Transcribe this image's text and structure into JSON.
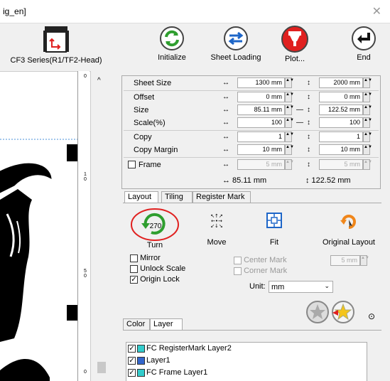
{
  "window": {
    "title": "ig_en]"
  },
  "toolbar": {
    "device": "CF3 Series(R1/TF2-Head)",
    "initialize": "Initialize",
    "sheet_loading": "Sheet Loading",
    "plot": "Plot...",
    "end": "End"
  },
  "ruler": {
    "labels": [
      "0",
      "1 0",
      "5 0",
      "0"
    ]
  },
  "params": {
    "sheet_size": {
      "label": "Sheet Size",
      "w": "1300 mm",
      "h": "2000 mm"
    },
    "offset": {
      "label": "Offset",
      "w": "0 mm",
      "h": "0 mm"
    },
    "size": {
      "label": "Size",
      "w": "85.11 mm",
      "h": "122.52 mm"
    },
    "scale": {
      "label": "Scale(%)",
      "w": "100",
      "h": "100"
    },
    "copy": {
      "label": "Copy",
      "w": "1",
      "h": "1"
    },
    "copy_margin": {
      "label": "Copy Margin",
      "w": "10 mm",
      "h": "10 mm"
    },
    "frame": {
      "label": "Frame",
      "w": "5 mm",
      "h": "5 mm"
    },
    "total_w": "↔ 85.11 mm",
    "total_h": "↕ 122.52 mm"
  },
  "tabs": [
    "Layout",
    "Tiling",
    "Register Mark"
  ],
  "layout": {
    "turn": "Turn",
    "turn_angle": "270",
    "move": "Move",
    "fit": "Fit",
    "original_layout": "Original Layout",
    "mirror": "Mirror",
    "unlock_scale": "Unlock Scale",
    "origin_lock": "Origin Lock",
    "center_mark": "Center Mark",
    "corner_mark": "Corner Mark",
    "mark_size": "5 mm",
    "unit_label": "Unit:",
    "unit_value": "mm"
  },
  "layer_tabs": [
    "Color",
    "Layer"
  ],
  "layers": [
    {
      "name": "FC RegisterMark Layer2",
      "color": "#33cccc",
      "checked": true
    },
    {
      "name": "Layer1",
      "color": "#3366cc",
      "checked": true
    },
    {
      "name": "FC Frame Layer1",
      "color": "#33cccc",
      "checked": true
    }
  ],
  "colors": {
    "accent_red": "#e0201f",
    "green": "#2f9e2f",
    "blue": "#1e66c8",
    "orange": "#f0861a"
  }
}
